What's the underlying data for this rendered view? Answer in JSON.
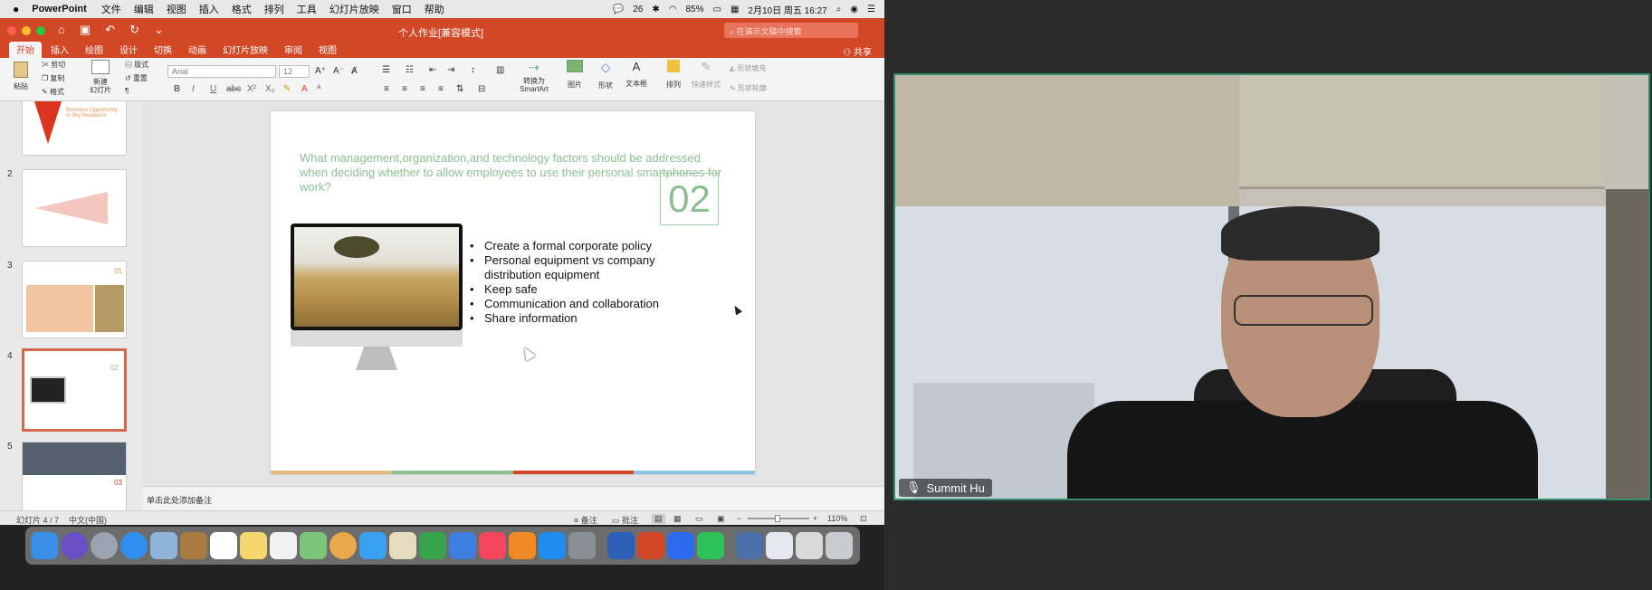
{
  "menubar": {
    "apple_icon": "apple-icon",
    "app_name": "PowerPoint",
    "items": [
      "文件",
      "编辑",
      "视图",
      "插入",
      "格式",
      "排列",
      "工具",
      "幻灯片放映",
      "窗口",
      "帮助"
    ],
    "battery": "85%",
    "datetime": "2月10日 周五 16:27",
    "wechat_badge": "26"
  },
  "titlebar": {
    "doc_title": "个人作业[兼容模式]",
    "search_placeholder": "在演示文稿中搜索"
  },
  "tabs": {
    "items": [
      "开始",
      "插入",
      "绘图",
      "设计",
      "切换",
      "动画",
      "幻灯片放映",
      "审阅",
      "视图"
    ],
    "share": "共享"
  },
  "ribbon": {
    "paste": "粘贴",
    "cut": "剪切",
    "copy": "复制",
    "format": "格式",
    "new_slide": "新建\n幻灯片",
    "layout": "版式",
    "reset": "重置",
    "font_name": "Arial",
    "font_size": "12",
    "convert_smartart": "转换为\nSmartArt",
    "picture": "图片",
    "shape": "形状",
    "textbox": "文本框",
    "arrange": "排列",
    "quick_styles": "快速样式",
    "shape_fill": "形状填充",
    "shape_outline": "形状轮廓"
  },
  "thumbnails": [
    {
      "num": "",
      "caption": "Business Opportunity or Big Headache"
    },
    {
      "num": "2",
      "caption": ""
    },
    {
      "num": "3",
      "caption": "01"
    },
    {
      "num": "4",
      "caption": "02"
    },
    {
      "num": "5",
      "caption": "03"
    }
  ],
  "slide": {
    "question": "What management,organization,and technology factors should be addressed when deciding whether to allow employees to use their personal smartphones for work?",
    "number": "02",
    "bullets": [
      "Create a formal corporate policy",
      "Personal equipment vs company distribution equipment",
      "Keep safe",
      "Communication and collaboration",
      "Share information"
    ],
    "bar_colors": [
      "#e8b981",
      "#8cbf8f",
      "#d24726",
      "#8ec3e3"
    ]
  },
  "notes": {
    "placeholder": "单击此处添加备注"
  },
  "statusbar": {
    "slide_count": "幻灯片 4 / 7",
    "language": "中文(中国)",
    "notes_label": "备注",
    "comments_label": "批注",
    "zoom": "110%"
  },
  "video": {
    "participant_name": "Summit Hu"
  },
  "colors": {
    "accent": "#d24726",
    "slide_green": "#8cbf8f",
    "video_border": "#2f8f6a"
  }
}
